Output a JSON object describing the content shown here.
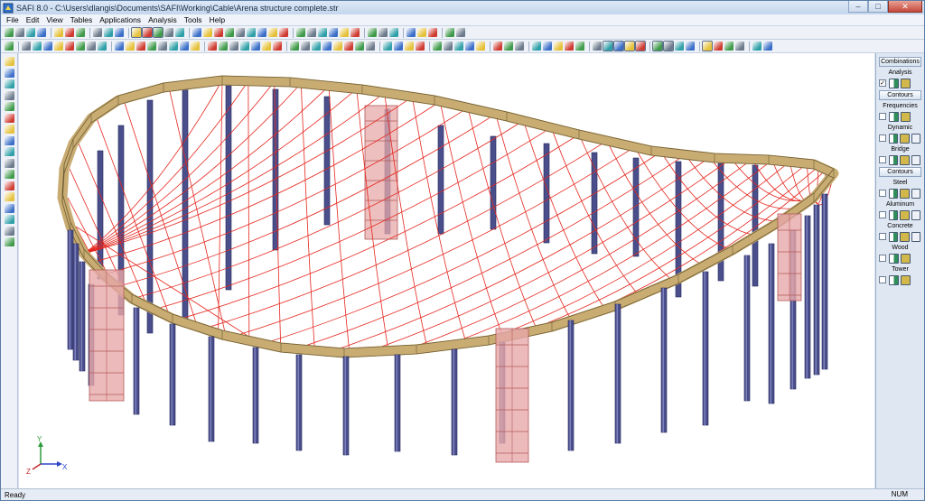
{
  "window": {
    "title": "SAFI 8.0 - C:\\Users\\dlangis\\Documents\\SAFI\\Working\\Cable\\Arena structure complete.str",
    "minimize": "–",
    "maximize": "□",
    "close": "✕"
  },
  "menu": {
    "items": [
      "File",
      "Edit",
      "View",
      "Tables",
      "Applications",
      "Analysis",
      "Tools",
      "Help"
    ]
  },
  "toolbar_colors": {
    "blue": "#3b6fc8",
    "yellow": "#e5c13a",
    "red": "#cf3b30",
    "green": "#3f9a4a",
    "gray": "#6c7a8c",
    "teal": "#2f9fa8"
  },
  "right_panel": {
    "combinations_label": "Combinations",
    "groups": [
      {
        "label": "Analysis",
        "checked": true
      },
      {
        "label": "Contours",
        "is_header": true
      },
      {
        "label": "Frequencies",
        "checked": false
      },
      {
        "label": "Dynamic",
        "checked": false
      },
      {
        "label": "Bridge",
        "checked": false
      },
      {
        "label": "Contours",
        "is_header": true
      },
      {
        "label": "Steel",
        "checked": false
      },
      {
        "label": "Aluminum",
        "checked": false
      },
      {
        "label": "Concrete",
        "checked": false
      },
      {
        "label": "Wood",
        "checked": false
      },
      {
        "label": "Tower",
        "checked": false
      }
    ]
  },
  "model_view": {
    "axis_labels": {
      "x": "X",
      "y": "Y",
      "z": "Z"
    },
    "colors": {
      "ring_beam": "#c8ac72",
      "ring_edge": "#6e5c33",
      "cable_net": "#e5261e",
      "column": "#4a4f8c",
      "column_light": "#7c80bd",
      "tower": "#e7a9a9",
      "tower_edge": "#b45a5a"
    }
  },
  "status": {
    "left": "Ready",
    "right": "NUM"
  }
}
